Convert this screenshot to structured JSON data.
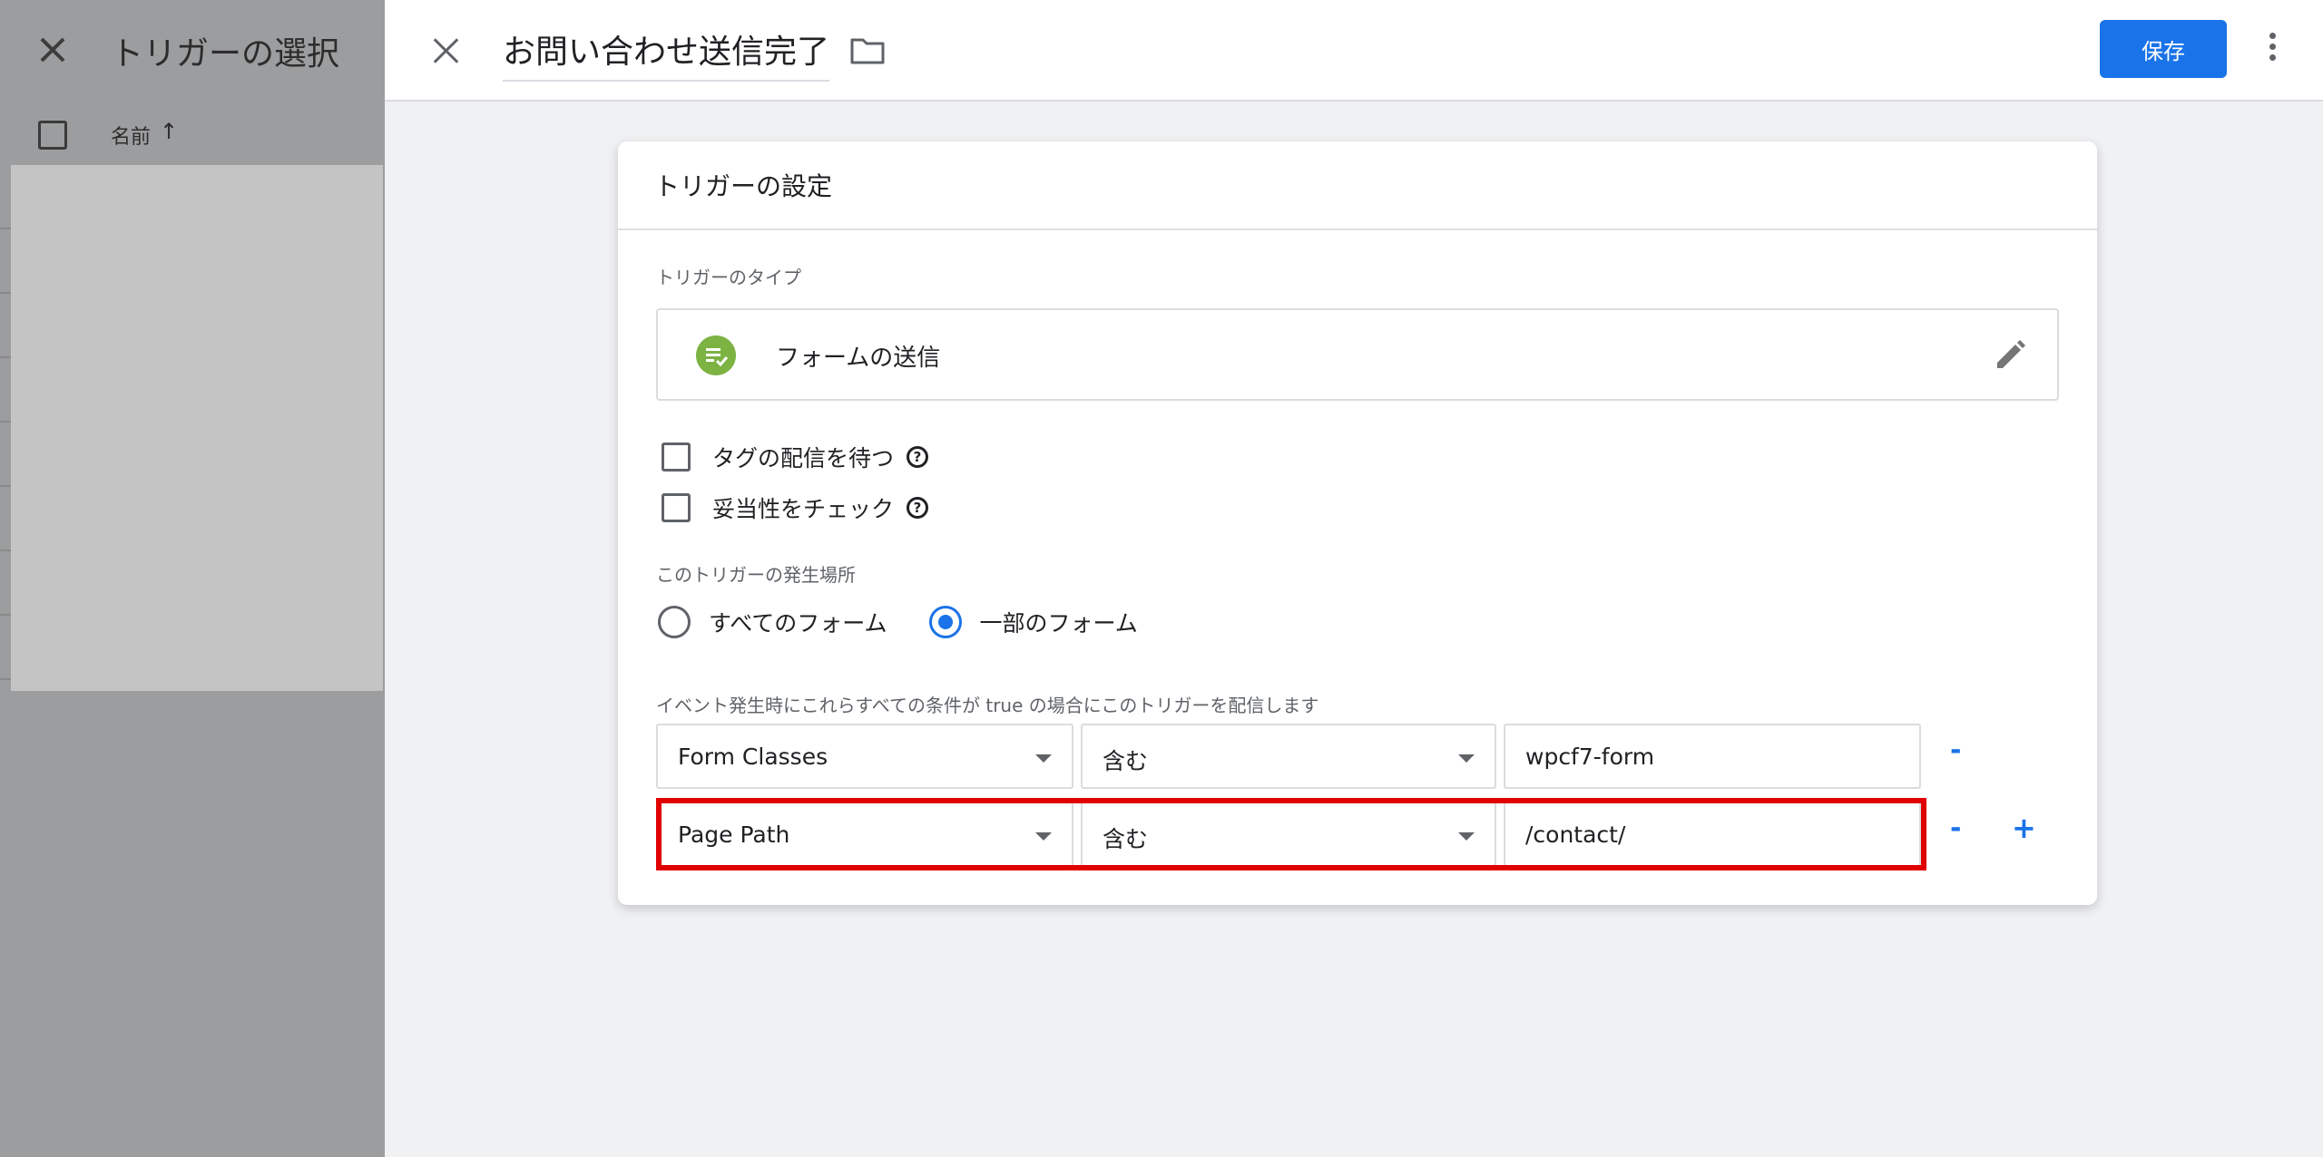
{
  "background": {
    "title": "トリガーの選択",
    "column_name": "名前",
    "sort_arrow": "↑"
  },
  "topbar": {
    "tag_title": "お問い合わせ送信完了",
    "save_label": "保存"
  },
  "card": {
    "header": "トリガーの設定",
    "type_label": "トリガーのタイプ",
    "type_name": "フォームの送信",
    "options": [
      {
        "label": "タグの配信を待つ",
        "checked": false
      },
      {
        "label": "妥当性をチェック",
        "checked": false
      }
    ],
    "help_glyph": "?",
    "fire_location_label": "このトリガーの発生場所",
    "radios": [
      {
        "label": "すべてのフォーム",
        "selected": false
      },
      {
        "label": "一部のフォーム",
        "selected": true
      }
    ],
    "conditions_label": "イベント発生時にこれらすべての条件が true の場合にこのトリガーを配信します",
    "conditions": [
      {
        "variable": "Form Classes",
        "operator": "含む",
        "value": "wpcf7-form"
      },
      {
        "variable": "Page Path",
        "operator": "含む",
        "value": "/contact/"
      }
    ],
    "minus_label": "-",
    "plus_label": "+"
  },
  "colors": {
    "accent": "#1a73e8",
    "form_icon": "#7cb342",
    "highlight": "#e00000"
  }
}
